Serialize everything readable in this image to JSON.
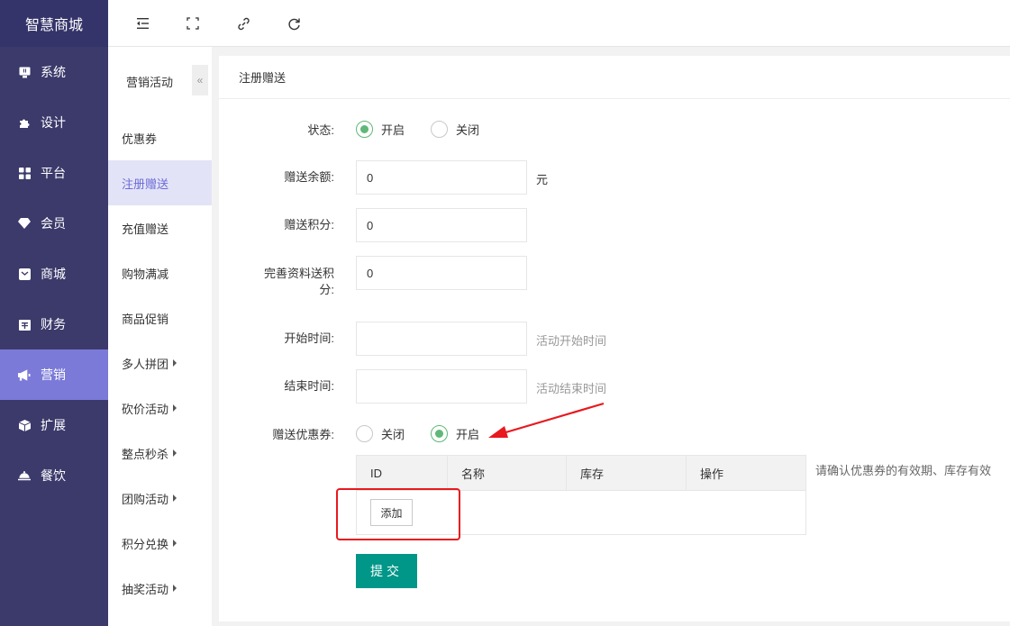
{
  "brand": "智慧商城",
  "sidebar": {
    "items": [
      {
        "label": "系统",
        "icon": "monitor-icon"
      },
      {
        "label": "设计",
        "icon": "puzzle-icon"
      },
      {
        "label": "平台",
        "icon": "grid-icon"
      },
      {
        "label": "会员",
        "icon": "diamond-icon"
      },
      {
        "label": "商城",
        "icon": "mail-icon"
      },
      {
        "label": "财务",
        "icon": "wallet-icon"
      },
      {
        "label": "营销",
        "icon": "megaphone-icon",
        "active": true
      },
      {
        "label": "扩展",
        "icon": "cube-icon"
      },
      {
        "label": "餐饮",
        "icon": "cloche-icon"
      }
    ]
  },
  "toolbar": {
    "icons": [
      "indent-icon",
      "fullscreen-icon",
      "link-icon",
      "refresh-icon"
    ]
  },
  "submenu": {
    "title": "营销活动",
    "collapse_glyph": "«",
    "items": [
      {
        "label": "优惠券"
      },
      {
        "label": "注册赠送",
        "active": true
      },
      {
        "label": "充值赠送"
      },
      {
        "label": "购物满减"
      },
      {
        "label": "商品促销"
      },
      {
        "label": "多人拼团",
        "has_children": true
      },
      {
        "label": "砍价活动",
        "has_children": true
      },
      {
        "label": "整点秒杀",
        "has_children": true
      },
      {
        "label": "团购活动",
        "has_children": true
      },
      {
        "label": "积分兑换",
        "has_children": true
      },
      {
        "label": "抽奖活动",
        "has_children": true
      }
    ]
  },
  "panel": {
    "title": "注册赠送",
    "form": {
      "status_label": "状态:",
      "status_on": "开启",
      "status_off": "关闭",
      "balance_label": "赠送余额:",
      "balance_value": "0",
      "balance_unit": "元",
      "points_label": "赠送积分:",
      "points_value": "0",
      "profile_points_label_1": "完善资料送积",
      "profile_points_label_2": "分:",
      "profile_points_value": "0",
      "start_label": "开始时间:",
      "start_value": "",
      "start_hint": "活动开始时间",
      "end_label": "结束时间:",
      "end_value": "",
      "end_hint": "活动结束时间",
      "coupon_label": "赠送优惠券:",
      "coupon_off": "关闭",
      "coupon_on": "开启"
    },
    "coupon_table": {
      "columns": [
        "ID",
        "名称",
        "库存",
        "操作"
      ],
      "add_label": "添加",
      "note": "请确认优惠券的有效期、库存有效"
    },
    "submit_label": "提交"
  },
  "colors": {
    "sidebar_bg": "#3b3a6b",
    "sidebar_active": "#7b7ad9",
    "radio_checked": "#5fb878",
    "submit_bg": "#009688",
    "annotation_red": "#e8191f"
  }
}
